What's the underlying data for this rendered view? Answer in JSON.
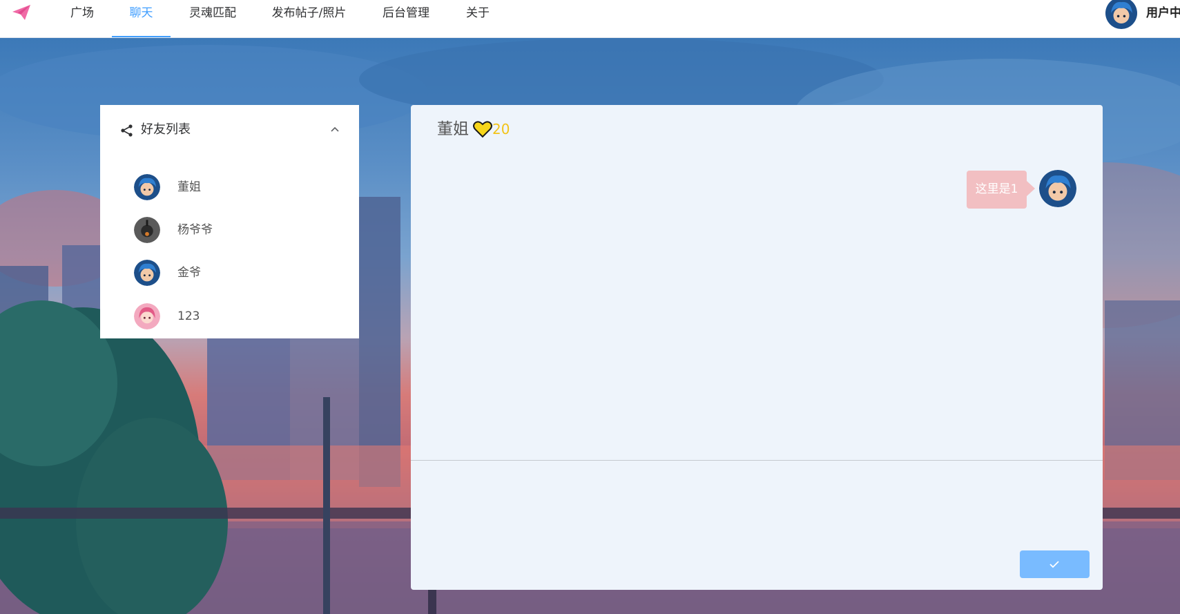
{
  "nav": {
    "items": [
      {
        "label": "广场",
        "active": false
      },
      {
        "label": "聊天",
        "active": true
      },
      {
        "label": "灵魂匹配",
        "active": false
      },
      {
        "label": "发布帖子/照片",
        "active": false
      },
      {
        "label": "后台管理",
        "active": false
      },
      {
        "label": "关于",
        "active": false
      }
    ],
    "user_label": "用户中心",
    "logo_icon": "paper-plane-icon",
    "accent": "#409eff"
  },
  "friends": {
    "title": "好友列表",
    "share_icon": "share-icon",
    "collapse_icon": "chevron-up-icon",
    "items": [
      {
        "name": "董姐",
        "avatar": "boy-avatar"
      },
      {
        "name": "杨爷爷",
        "avatar": "dark-avatar"
      },
      {
        "name": "金爷",
        "avatar": "boy-avatar"
      },
      {
        "name": "123",
        "avatar": "girl-avatar"
      }
    ]
  },
  "chat": {
    "contact_name": "董姐",
    "heart_icon": "heart-icon",
    "heart_count": "20",
    "heart_color": "#f2c318",
    "messages": [
      {
        "text": "这里是1",
        "side": "right",
        "bubble_color": "#f2bfc2"
      }
    ],
    "send_icon": "check-icon",
    "send_color": "#79bbff"
  }
}
